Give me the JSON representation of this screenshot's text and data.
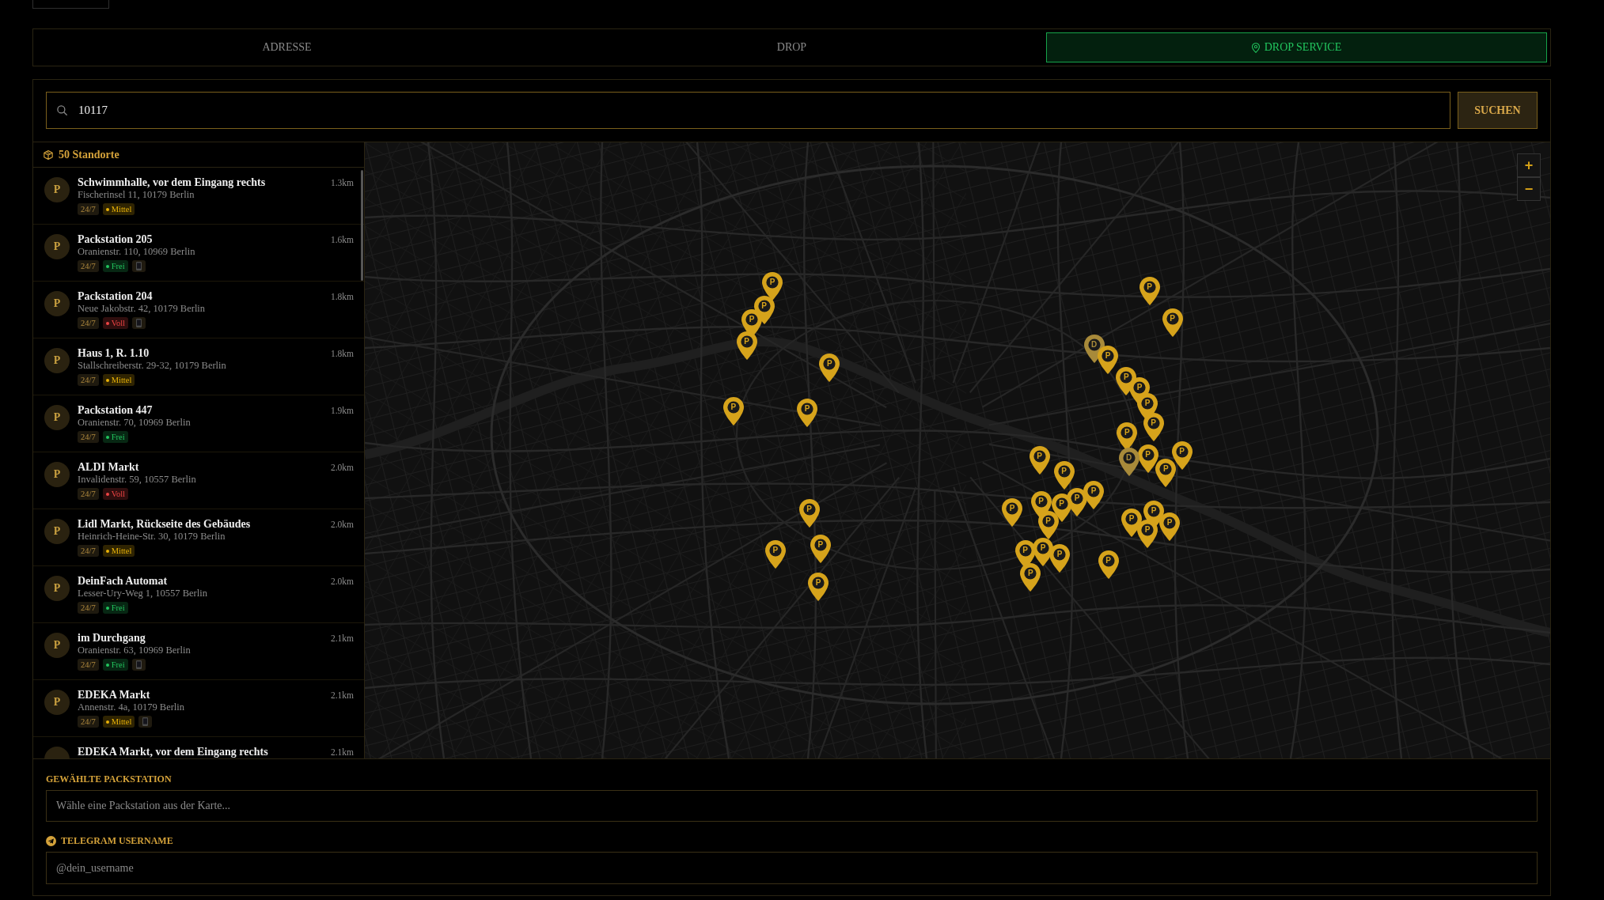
{
  "tabs": [
    {
      "label": "ADRESSE",
      "selected": false
    },
    {
      "label": "DROP",
      "selected": false
    },
    {
      "label": "DROP SERVICE",
      "selected": true
    }
  ],
  "search": {
    "value": "10117",
    "button": "SUCHEN"
  },
  "locations": {
    "count": "50 Standorte",
    "items": [
      {
        "avatar": "P",
        "name": "Schwimmhalle, vor dem Eingang rechts",
        "address": "Fischerinsel 11, 10179 Berlin",
        "distance": "1.3km",
        "hours": "24/7",
        "status": {
          "label": "Mittel",
          "color": "#eab308"
        },
        "app_tag": false
      },
      {
        "avatar": "P",
        "name": "Packstation 205",
        "address": "Oranienstr. 110, 10969 Berlin",
        "distance": "1.6km",
        "hours": "24/7",
        "status": {
          "label": "Frei",
          "color": "#22c55e"
        },
        "app_tag": true
      },
      {
        "avatar": "P",
        "name": "Packstation 204",
        "address": "Neue Jakobstr. 42, 10179 Berlin",
        "distance": "1.8km",
        "hours": "24/7",
        "status": {
          "label": "Voll",
          "color": "#ef4444"
        },
        "app_tag": true
      },
      {
        "avatar": "P",
        "name": "Haus 1, R. 1.10",
        "address": "Stallschreiberstr. 29-32, 10179 Berlin",
        "distance": "1.8km",
        "hours": "24/7",
        "status": {
          "label": "Mittel",
          "color": "#eab308"
        },
        "app_tag": false
      },
      {
        "avatar": "P",
        "name": "Packstation 447",
        "address": "Oranienstr. 70, 10969 Berlin",
        "distance": "1.9km",
        "hours": "24/7",
        "status": {
          "label": "Frei",
          "color": "#22c55e"
        },
        "app_tag": false
      },
      {
        "avatar": "P",
        "name": "ALDI Markt",
        "address": "Invalidenstr. 59, 10557 Berlin",
        "distance": "2.0km",
        "hours": "24/7",
        "status": {
          "label": "Voll",
          "color": "#ef4444"
        },
        "app_tag": false
      },
      {
        "avatar": "P",
        "name": "Lidl Markt, Rückseite des Gebäudes",
        "address": "Heinrich-Heine-Str. 30, 10179 Berlin",
        "distance": "2.0km",
        "hours": "24/7",
        "status": {
          "label": "Mittel",
          "color": "#eab308"
        },
        "app_tag": false
      },
      {
        "avatar": "P",
        "name": "DeinFach Automat",
        "address": "Lesser-Ury-Weg 1, 10557 Berlin",
        "distance": "2.0km",
        "hours": "24/7",
        "status": {
          "label": "Frei",
          "color": "#22c55e"
        },
        "app_tag": false
      },
      {
        "avatar": "P",
        "name": "im Durchgang",
        "address": "Oranienstr. 63, 10969 Berlin",
        "distance": "2.1km",
        "hours": "24/7",
        "status": {
          "label": "Frei",
          "color": "#22c55e"
        },
        "app_tag": true
      },
      {
        "avatar": "P",
        "name": "EDEKA Markt",
        "address": "Annenstr. 4a, 10179 Berlin",
        "distance": "2.1km",
        "hours": "24/7",
        "status": {
          "label": "Mittel",
          "color": "#eab308"
        },
        "app_tag": true
      },
      {
        "name": "EDEKA Markt, vor dem Eingang rechts",
        "distance": "2.1km"
      }
    ]
  },
  "map": {
    "zoom_in": "+",
    "zoom_out": "−",
    "markers": [
      {
        "label": "P",
        "color": "#d6a31b"
      },
      {
        "label": "P",
        "color": "#d6a31b"
      },
      {
        "label": "P",
        "color": "#d6a31b"
      },
      {
        "label": "P",
        "color": "#d6a31b"
      },
      {
        "label": "P",
        "color": "#d6a31b"
      },
      {
        "label": "P",
        "color": "#d6a31b"
      },
      {
        "label": "D",
        "color": "#a88a3a"
      },
      {
        "label": "P",
        "color": "#d6a31b"
      },
      {
        "label": "P",
        "color": "#d6a31b"
      },
      {
        "label": "P",
        "color": "#d6a31b"
      },
      {
        "label": "P",
        "color": "#d6a31b"
      },
      {
        "label": "P",
        "color": "#d6a31b"
      },
      {
        "label": "P",
        "color": "#d6a31b"
      },
      {
        "label": "P",
        "color": "#d6a31b"
      },
      {
        "label": "P",
        "color": "#d6a31b"
      },
      {
        "label": "P",
        "color": "#d6a31b"
      },
      {
        "label": "P",
        "color": "#d6a31b"
      },
      {
        "label": "D",
        "color": "#a88a3a"
      },
      {
        "label": "P",
        "color": "#d6a31b"
      },
      {
        "label": "P",
        "color": "#d6a31b"
      },
      {
        "label": "P",
        "color": "#d6a31b"
      },
      {
        "label": "P",
        "color": "#d6a31b"
      },
      {
        "label": "P",
        "color": "#d6a31b"
      },
      {
        "label": "P",
        "color": "#d6a31b"
      },
      {
        "label": "P",
        "color": "#d6a31b"
      },
      {
        "label": "P",
        "color": "#d6a31b"
      },
      {
        "label": "P",
        "color": "#d6a31b"
      },
      {
        "label": "P",
        "color": "#d6a31b"
      },
      {
        "label": "P",
        "color": "#d6a31b"
      },
      {
        "label": "P",
        "color": "#d6a31b"
      },
      {
        "label": "P",
        "color": "#d6a31b"
      },
      {
        "label": "P",
        "color": "#d6a31b"
      },
      {
        "label": "P",
        "color": "#d6a31b"
      },
      {
        "label": "P",
        "color": "#d6a31b"
      },
      {
        "label": "P",
        "color": "#d6a31b"
      },
      {
        "label": "P",
        "color": "#d6a31b"
      },
      {
        "label": "P",
        "color": "#d6a31b"
      },
      {
        "label": "P",
        "color": "#d6a31b"
      },
      {
        "label": "P",
        "color": "#d6a31b"
      },
      {
        "label": "P",
        "color": "#d6a31b"
      },
      {
        "label": "P",
        "color": "#d6a31b"
      }
    ]
  },
  "selected_station": {
    "label": "GEWÄHLTE PACKSTATION",
    "placeholder": "Wähle eine Packstation aus der Karte..."
  },
  "telegram": {
    "label": "TELEGRAM USERNAME",
    "placeholder": "@dein_username"
  }
}
